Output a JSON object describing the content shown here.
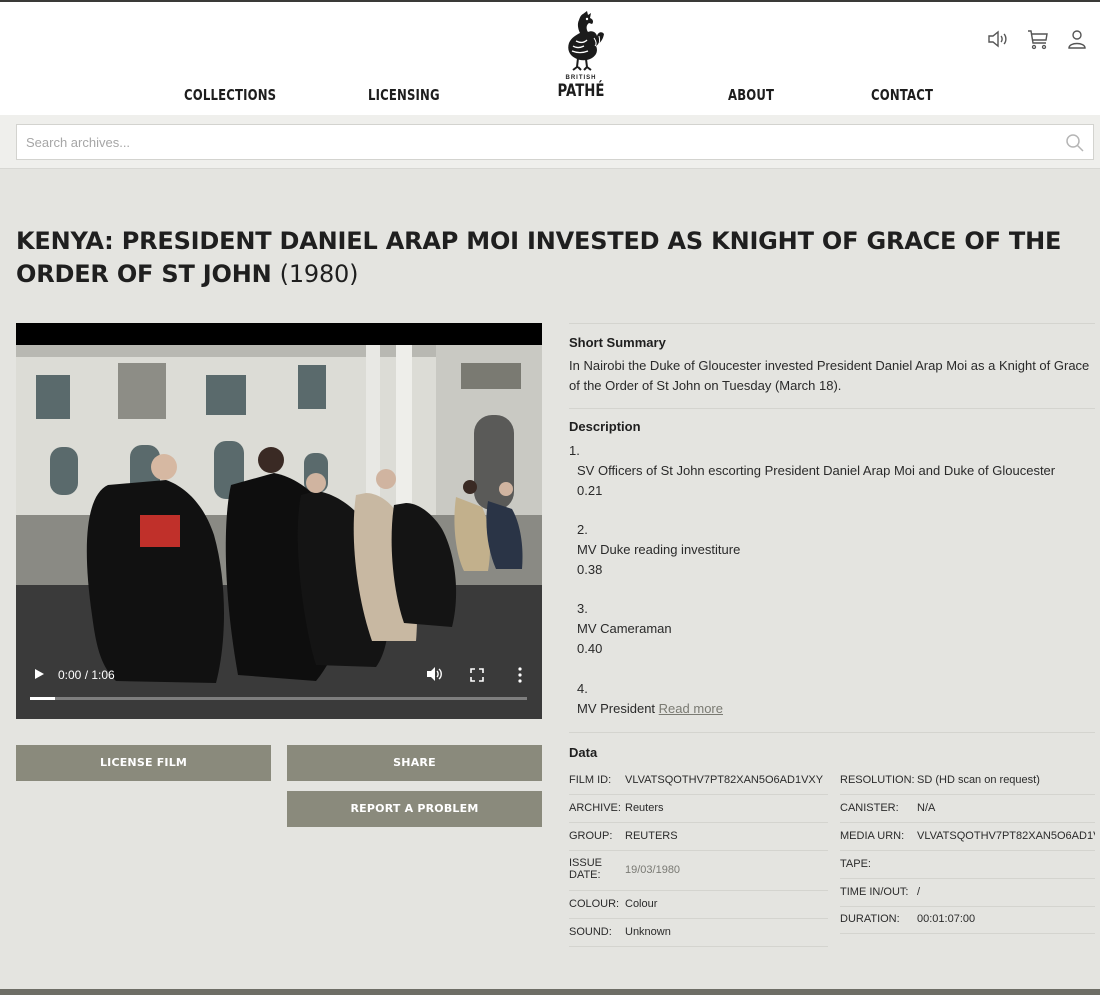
{
  "header": {
    "logo_small": "BRITISH",
    "logo_main": "PATHÉ",
    "nav": [
      "COLLECTIONS",
      "LICENSING",
      "ABOUT",
      "CONTACT"
    ],
    "icons": [
      "speaker-icon",
      "cart-icon",
      "user-icon"
    ]
  },
  "search": {
    "placeholder": "Search archives..."
  },
  "film": {
    "title": "KENYA: PRESIDENT DANIEL ARAP MOI INVESTED AS KNIGHT OF GRACE OF THE ORDER OF ST JOHN",
    "year": "(1980)"
  },
  "video": {
    "time": "0:00 / 1:06",
    "progress": 0.05
  },
  "actions": {
    "license": "LICENSE FILM",
    "share": "SHARE",
    "report": "REPORT A PROBLEM"
  },
  "summary": {
    "title": "Short Summary",
    "text": "In Nairobi the Duke of Gloucester invested President Daniel Arap Moi as a Knight of Grace of the Order of St John on Tuesday (March 18)."
  },
  "description": {
    "title": "Description",
    "items": [
      {
        "num": "1.",
        "shot": "SV Officers of St John escorting President Daniel Arap Moi and Duke of Gloucester",
        "time": "0.21"
      },
      {
        "num": "2.",
        "shot": "MV Duke reading investiture",
        "time": "0.38"
      },
      {
        "num": "3.",
        "shot": "MV Cameraman",
        "time": "0.40"
      },
      {
        "num": "4.",
        "shot": "MV President"
      }
    ],
    "read_more": "Read more"
  },
  "data": {
    "title": "Data",
    "left": [
      {
        "label": "FILM ID:",
        "value": "VLVATSQOTHV7PT82XAN5O6AD1VXY"
      },
      {
        "label": "ARCHIVE:",
        "value": "Reuters"
      },
      {
        "label": "GROUP:",
        "value": "REUTERS"
      },
      {
        "label": "ISSUE DATE:",
        "value": "19/03/1980"
      },
      {
        "label": "COLOUR:",
        "value": "Colour"
      },
      {
        "label": "SOUND:",
        "value": "Unknown"
      }
    ],
    "right": [
      {
        "label": "RESOLUTION:",
        "value": "SD (HD scan on request)"
      },
      {
        "label": "CANISTER:",
        "value": "N/A"
      },
      {
        "label": "MEDIA URN:",
        "value": "VLVATSQOTHV7PT82XAN5O6AD1VXY"
      },
      {
        "label": "TAPE:",
        "value": ""
      },
      {
        "label": "TIME IN/OUT:",
        "value": "/"
      },
      {
        "label": "DURATION:",
        "value": "00:01:07:00"
      }
    ]
  }
}
